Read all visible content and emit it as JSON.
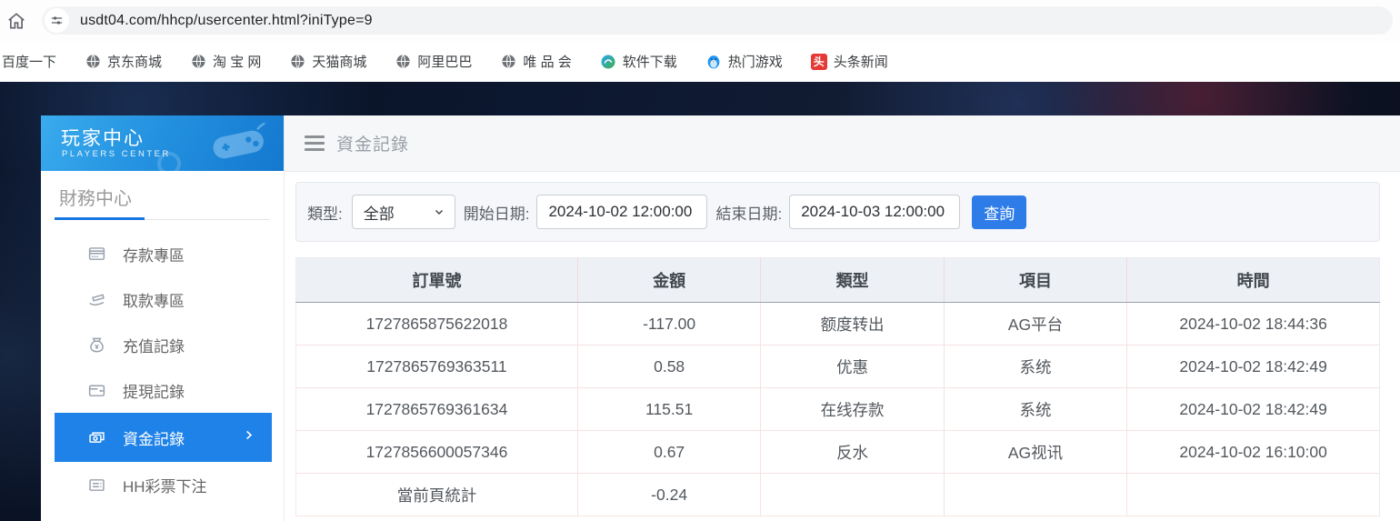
{
  "browser": {
    "url": "usdt04.com/hhcp/usercenter.html?iniType=9",
    "bookmarks": [
      {
        "label": "百度一下",
        "icon": "none"
      },
      {
        "label": "京东商城",
        "icon": "globe"
      },
      {
        "label": "淘 宝 网",
        "icon": "globe"
      },
      {
        "label": "天猫商城",
        "icon": "globe"
      },
      {
        "label": "阿里巴巴",
        "icon": "globe"
      },
      {
        "label": "唯 品 会",
        "icon": "globe"
      },
      {
        "label": "软件下载",
        "icon": "software"
      },
      {
        "label": "热门游戏",
        "icon": "penguin"
      },
      {
        "label": "头条新闻",
        "icon": "toutiao",
        "glyph": "头"
      }
    ]
  },
  "sidebar": {
    "title": "玩家中心",
    "subtitle": "PLAYERS CENTER",
    "section": "財務中心",
    "items": [
      {
        "label": "存款專區",
        "icon": "deposit-icon",
        "active": false
      },
      {
        "label": "取款專區",
        "icon": "withdraw-icon",
        "active": false
      },
      {
        "label": "充值記錄",
        "icon": "recharge-icon",
        "active": false
      },
      {
        "label": "提現記錄",
        "icon": "withdrawal-record-icon",
        "active": false
      },
      {
        "label": "資金記錄",
        "icon": "funds-record-icon",
        "active": true
      },
      {
        "label": "HH彩票下注",
        "icon": "lottery-icon",
        "active": false
      }
    ]
  },
  "main": {
    "page_title": "資金記錄",
    "filters": {
      "type_label": "類型:",
      "type_value": "全部",
      "start_label": "開始日期:",
      "start_value": "2024-10-02 12:00:00",
      "end_label": "結束日期:",
      "end_value": "2024-10-03 12:00:00",
      "search_label": "查詢"
    },
    "table": {
      "headers": [
        "訂單號",
        "金額",
        "類型",
        "項目",
        "時間"
      ],
      "rows": [
        [
          "1727865875622018",
          "-117.00",
          "额度转出",
          "AG平台",
          "2024-10-02 18:44:36"
        ],
        [
          "1727865769363511",
          "0.58",
          "优惠",
          "系统",
          "2024-10-02 18:42:49"
        ],
        [
          "1727865769361634",
          "115.51",
          "在线存款",
          "系统",
          "2024-10-02 18:42:49"
        ],
        [
          "1727856600057346",
          "0.67",
          "反水",
          "AG视讯",
          "2024-10-02 16:10:00"
        ],
        [
          "當前頁統計",
          "-0.24",
          "",
          "",
          ""
        ]
      ]
    }
  },
  "colors": {
    "accent_blue": "#2e7ce8",
    "sidebar_active": "#1e82e8",
    "banner_blue": "#2492e0",
    "table_header_bg": "#edf1f6",
    "table_border_pink": "#f6e2e2",
    "toutiao_red": "#e53935"
  }
}
